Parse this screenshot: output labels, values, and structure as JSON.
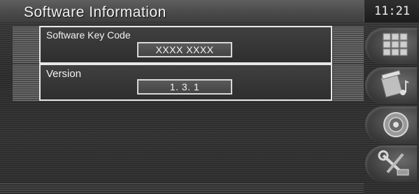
{
  "header": {
    "title": "Software Information",
    "clock": "11:21"
  },
  "software_key": {
    "label": "Software Key Code",
    "value": "XXXX XXXX"
  },
  "version": {
    "label": "Version",
    "value": "1. 3. 1"
  },
  "sidebar": {
    "items": [
      {
        "icon": "menu-grid-icon"
      },
      {
        "icon": "film-music-icon"
      },
      {
        "icon": "speaker-icon"
      },
      {
        "icon": "setup-tools-icon"
      }
    ]
  },
  "colors": {
    "background": "#2e2e2e",
    "panel_border": "#e8e8e8",
    "text": "#f2f2f2"
  }
}
